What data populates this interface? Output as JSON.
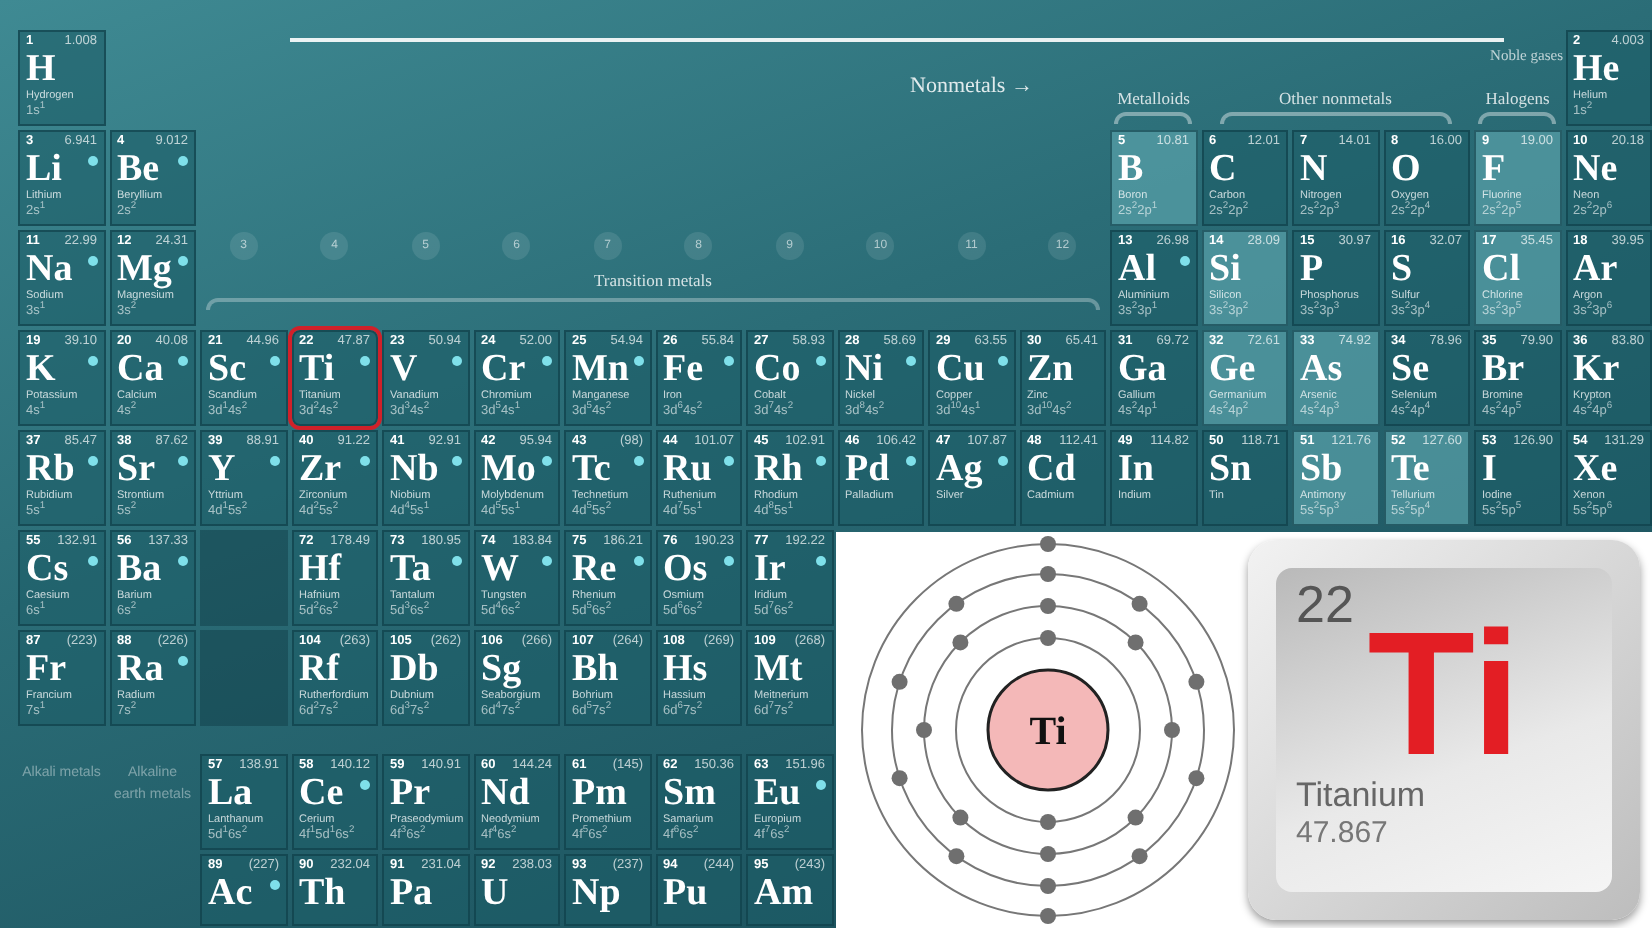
{
  "category_labels": {
    "nonmetals": "Nonmetals →",
    "metalloids": "Metalloids",
    "other_nonmetals": "Other nonmetals",
    "halogens": "Halogens",
    "noble_gases": "Noble gases",
    "transition_metals": "Transition metals",
    "alkali_metals": "Alkali metals",
    "alkaline_earth_metals": "Alkaline earth metals"
  },
  "group_numbers": [
    "3",
    "4",
    "5",
    "6",
    "7",
    "8",
    "9",
    "10",
    "11",
    "12"
  ],
  "elements": [
    {
      "number": "1",
      "mass": "1.008",
      "symbol": "H",
      "name": "Hydrogen",
      "config": "1s$^{1}$"
    },
    {
      "number": "2",
      "mass": "4.003",
      "symbol": "He",
      "name": "Helium",
      "config": "1s$^{2}$"
    },
    {
      "number": "3",
      "mass": "6.941",
      "symbol": "Li",
      "name": "Lithium",
      "config": "2s$^{1}$",
      "dot": true
    },
    {
      "number": "4",
      "mass": "9.012",
      "symbol": "Be",
      "name": "Beryllium",
      "config": "2s$^{2}$",
      "dot": true
    },
    {
      "number": "5",
      "mass": "10.81",
      "symbol": "B",
      "name": "Boron",
      "config": "2s$^{2}$2p$^{1}$",
      "light": true
    },
    {
      "number": "6",
      "mass": "12.01",
      "symbol": "C",
      "name": "Carbon",
      "config": "2s$^{2}$2p$^{2}$"
    },
    {
      "number": "7",
      "mass": "14.01",
      "symbol": "N",
      "name": "Nitrogen",
      "config": "2s$^{2}$2p$^{3}$"
    },
    {
      "number": "8",
      "mass": "16.00",
      "symbol": "O",
      "name": "Oxygen",
      "config": "2s$^{2}$2p$^{4}$"
    },
    {
      "number": "9",
      "mass": "19.00",
      "symbol": "F",
      "name": "Fluorine",
      "config": "2s$^{2}$2p$^{5}$",
      "light": true
    },
    {
      "number": "10",
      "mass": "20.18",
      "symbol": "Ne",
      "name": "Neon",
      "config": "2s$^{2}$2p$^{6}$"
    },
    {
      "number": "11",
      "mass": "22.99",
      "symbol": "Na",
      "name": "Sodium",
      "config": "3s$^{1}$",
      "dot": true
    },
    {
      "number": "12",
      "mass": "24.31",
      "symbol": "Mg",
      "name": "Magnesium",
      "config": "3s$^{2}$",
      "dot": true
    },
    {
      "number": "13",
      "mass": "26.98",
      "symbol": "Al",
      "name": "Aluminium",
      "config": "3s$^{2}$3p$^{1}$",
      "dot": true
    },
    {
      "number": "14",
      "mass": "28.09",
      "symbol": "Si",
      "name": "Silicon",
      "config": "3s$^{2}$3p$^{2}$",
      "light": true
    },
    {
      "number": "15",
      "mass": "30.97",
      "symbol": "P",
      "name": "Phosphorus",
      "config": "3s$^{2}$3p$^{3}$"
    },
    {
      "number": "16",
      "mass": "32.07",
      "symbol": "S",
      "name": "Sulfur",
      "config": "3s$^{2}$3p$^{4}$"
    },
    {
      "number": "17",
      "mass": "35.45",
      "symbol": "Cl",
      "name": "Chlorine",
      "config": "3s$^{2}$3p$^{5}$",
      "light": true
    },
    {
      "number": "18",
      "mass": "39.95",
      "symbol": "Ar",
      "name": "Argon",
      "config": "3s$^{2}$3p$^{6}$"
    },
    {
      "number": "19",
      "mass": "39.10",
      "symbol": "K",
      "name": "Potassium",
      "config": "4s$^{1}$",
      "dot": true
    },
    {
      "number": "20",
      "mass": "40.08",
      "symbol": "Ca",
      "name": "Calcium",
      "config": "4s$^{2}$",
      "dot": true
    },
    {
      "number": "21",
      "mass": "44.96",
      "symbol": "Sc",
      "name": "Scandium",
      "config": "3d$^{1}$4s$^{2}$",
      "dot": true
    },
    {
      "number": "22",
      "mass": "47.87",
      "symbol": "Ti",
      "name": "Titanium",
      "config": "3d$^{2}$4s$^{2}$",
      "dot": true,
      "circled": true
    },
    {
      "number": "23",
      "mass": "50.94",
      "symbol": "V",
      "name": "Vanadium",
      "config": "3d$^{3}$4s$^{2}$",
      "dot": true
    },
    {
      "number": "24",
      "mass": "52.00",
      "symbol": "Cr",
      "name": "Chromium",
      "config": "3d$^{5}$4s$^{1}$",
      "dot": true
    },
    {
      "number": "25",
      "mass": "54.94",
      "symbol": "Mn",
      "name": "Manganese",
      "config": "3d$^{5}$4s$^{2}$",
      "dot": true
    },
    {
      "number": "26",
      "mass": "55.84",
      "symbol": "Fe",
      "name": "Iron",
      "config": "3d$^{6}$4s$^{2}$",
      "dot": true
    },
    {
      "number": "27",
      "mass": "58.93",
      "symbol": "Co",
      "name": "Cobalt",
      "config": "3d$^{7}$4s$^{2}$",
      "dot": true
    },
    {
      "number": "28",
      "mass": "58.69",
      "symbol": "Ni",
      "name": "Nickel",
      "config": "3d$^{8}$4s$^{2}$",
      "dot": true
    },
    {
      "number": "29",
      "mass": "63.55",
      "symbol": "Cu",
      "name": "Copper",
      "config": "3d$^{10}$4s$^{1}$",
      "dot": true
    },
    {
      "number": "30",
      "mass": "65.41",
      "symbol": "Zn",
      "name": "Zinc",
      "config": "3d$^{10}$4s$^{2}$"
    },
    {
      "number": "31",
      "mass": "69.72",
      "symbol": "Ga",
      "name": "Gallium",
      "config": "4s$^{2}$4p$^{1}$"
    },
    {
      "number": "32",
      "mass": "72.61",
      "symbol": "Ge",
      "name": "Germanium",
      "config": "4s$^{2}$4p$^{2}$",
      "light": true
    },
    {
      "number": "33",
      "mass": "74.92",
      "symbol": "As",
      "name": "Arsenic",
      "config": "4s$^{2}$4p$^{3}$",
      "light": true
    },
    {
      "number": "34",
      "mass": "78.96",
      "symbol": "Se",
      "name": "Selenium",
      "config": "4s$^{2}$4p$^{4}$"
    },
    {
      "number": "35",
      "mass": "79.90",
      "symbol": "Br",
      "name": "Bromine",
      "config": "4s$^{2}$4p$^{5}$"
    },
    {
      "number": "36",
      "mass": "83.80",
      "symbol": "Kr",
      "name": "Krypton",
      "config": "4s$^{2}$4p$^{6}$"
    },
    {
      "number": "37",
      "mass": "85.47",
      "symbol": "Rb",
      "name": "Rubidium",
      "config": "5s$^{1}$",
      "dot": true
    },
    {
      "number": "38",
      "mass": "87.62",
      "symbol": "Sr",
      "name": "Strontium",
      "config": "5s$^{2}$",
      "dot": true
    },
    {
      "number": "39",
      "mass": "88.91",
      "symbol": "Y",
      "name": "Yttrium",
      "config": "4d$^{1}$5s$^{2}$",
      "dot": true
    },
    {
      "number": "40",
      "mass": "91.22",
      "symbol": "Zr",
      "name": "Zirconium",
      "config": "4d$^{2}$5s$^{2}$",
      "dot": true
    },
    {
      "number": "41",
      "mass": "92.91",
      "symbol": "Nb",
      "name": "Niobium",
      "config": "4d$^{4}$5s$^{1}$",
      "dot": true
    },
    {
      "number": "42",
      "mass": "95.94",
      "symbol": "Mo",
      "name": "Molybdenum",
      "config": "4d$^{5}$5s$^{1}$",
      "dot": true
    },
    {
      "number": "43",
      "mass": "(98)",
      "symbol": "Tc",
      "name": "Technetium",
      "config": "4d$^{5}$5s$^{2}$",
      "dot": true
    },
    {
      "number": "44",
      "mass": "101.07",
      "symbol": "Ru",
      "name": "Ruthenium",
      "config": "4d$^{7}$5s$^{1}$",
      "dot": true
    },
    {
      "number": "45",
      "mass": "102.91",
      "symbol": "Rh",
      "name": "Rhodium",
      "config": "4d$^{8}$5s$^{1}$",
      "dot": true
    },
    {
      "number": "46",
      "mass": "106.42",
      "symbol": "Pd",
      "name": "Palladium",
      "dot": true
    },
    {
      "number": "47",
      "mass": "107.87",
      "symbol": "Ag",
      "name": "Silver",
      "dot": true
    },
    {
      "number": "48",
      "mass": "112.41",
      "symbol": "Cd",
      "name": "Cadmium"
    },
    {
      "number": "49",
      "mass": "114.82",
      "symbol": "In",
      "name": "Indium"
    },
    {
      "number": "50",
      "mass": "118.71",
      "symbol": "Sn",
      "name": "Tin"
    },
    {
      "number": "51",
      "mass": "121.76",
      "symbol": "Sb",
      "name": "Antimony",
      "config": "5s$^{2}$5p$^{3}$",
      "light": true
    },
    {
      "number": "52",
      "mass": "127.60",
      "symbol": "Te",
      "name": "Tellurium",
      "config": "5s$^{2}$5p$^{4}$",
      "light": true
    },
    {
      "number": "53",
      "mass": "126.90",
      "symbol": "I",
      "name": "Iodine",
      "config": "5s$^{2}$5p$^{5}$"
    },
    {
      "number": "54",
      "mass": "131.29",
      "symbol": "Xe",
      "name": "Xenon",
      "config": "5s$^{2}$5p$^{6}$"
    },
    {
      "number": "55",
      "mass": "132.91",
      "symbol": "Cs",
      "name": "Caesium",
      "config": "6s$^{1}$",
      "dot": true
    },
    {
      "number": "56",
      "mass": "137.33",
      "symbol": "Ba",
      "name": "Barium",
      "config": "6s$^{2}$",
      "dot": true
    },
    {
      "number": "72",
      "mass": "178.49",
      "symbol": "Hf",
      "name": "Hafnium",
      "config": "5d$^{2}$6s$^{2}$"
    },
    {
      "number": "73",
      "mass": "180.95",
      "symbol": "Ta",
      "name": "Tantalum",
      "config": "5d$^{3}$6s$^{2}$",
      "dot": true
    },
    {
      "number": "74",
      "mass": "183.84",
      "symbol": "W",
      "name": "Tungsten",
      "config": "5d$^{4}$6s$^{2}$",
      "dot": true
    },
    {
      "number": "75",
      "mass": "186.21",
      "symbol": "Re",
      "name": "Rhenium",
      "config": "5d$^{5}$6s$^{2}$",
      "dot": true
    },
    {
      "number": "76",
      "mass": "190.23",
      "symbol": "Os",
      "name": "Osmium",
      "config": "5d$^{6}$6s$^{2}$",
      "dot": true
    },
    {
      "number": "77",
      "mass": "192.22",
      "symbol": "Ir",
      "name": "Iridium",
      "config": "5d$^{7}$6s$^{2}$",
      "dot": true
    },
    {
      "number": "87",
      "mass": "(223)",
      "symbol": "Fr",
      "name": "Francium",
      "config": "7s$^{1}$"
    },
    {
      "number": "88",
      "mass": "(226)",
      "symbol": "Ra",
      "name": "Radium",
      "config": "7s$^{2}$",
      "dot": true
    },
    {
      "number": "104",
      "mass": "(263)",
      "symbol": "Rf",
      "name": "Rutherfordium",
      "config": "6d$^{2}$7s$^{2}$"
    },
    {
      "number": "105",
      "mass": "(262)",
      "symbol": "Db",
      "name": "Dubnium",
      "config": "6d$^{3}$7s$^{2}$"
    },
    {
      "number": "106",
      "mass": "(266)",
      "symbol": "Sg",
      "name": "Seaborgium",
      "config": "6d$^{4}$7s$^{2}$"
    },
    {
      "number": "107",
      "mass": "(264)",
      "symbol": "Bh",
      "name": "Bohrium",
      "config": "6d$^{5}$7s$^{2}$"
    },
    {
      "number": "108",
      "mass": "(269)",
      "symbol": "Hs",
      "name": "Hassium",
      "config": "6d$^{6}$7s$^{2}$"
    },
    {
      "number": "109",
      "mass": "(268)",
      "symbol": "Mt",
      "name": "Meitnerium",
      "config": "6d$^{7}$7s$^{2}$"
    }
  ],
  "lanthanides": [
    {
      "number": "57",
      "mass": "138.91",
      "symbol": "La",
      "name": "Lanthanum",
      "config": "5d$^{1}$6s$^{2}$"
    },
    {
      "number": "58",
      "mass": "140.12",
      "symbol": "Ce",
      "name": "Cerium",
      "config": "4f$^{1}$5d$^{1}$6s$^{2}$",
      "dot": true
    },
    {
      "number": "59",
      "mass": "140.91",
      "symbol": "Pr",
      "name": "Praseodymium",
      "config": "4f$^{3}$6s$^{2}$"
    },
    {
      "number": "60",
      "mass": "144.24",
      "symbol": "Nd",
      "name": "Neodymium",
      "config": "4f$^{4}$6s$^{2}$"
    },
    {
      "number": "61",
      "mass": "(145)",
      "symbol": "Pm",
      "name": "Promethium",
      "config": "4f$^{5}$6s$^{2}$"
    },
    {
      "number": "62",
      "mass": "150.36",
      "symbol": "Sm",
      "name": "Samarium",
      "config": "4f$^{6}$6s$^{2}$"
    },
    {
      "number": "63",
      "mass": "151.96",
      "symbol": "Eu",
      "name": "Europium",
      "config": "4f$^{7}$6s$^{2}$",
      "dot": true
    }
  ],
  "actinides": [
    {
      "number": "89",
      "mass": "(227)",
      "symbol": "Ac",
      "dot": true
    },
    {
      "number": "90",
      "mass": "232.04",
      "symbol": "Th"
    },
    {
      "number": "91",
      "mass": "231.04",
      "symbol": "Pa"
    },
    {
      "number": "92",
      "mass": "238.03",
      "symbol": "U"
    },
    {
      "number": "93",
      "mass": "(237)",
      "symbol": "Np"
    },
    {
      "number": "94",
      "mass": "(244)",
      "symbol": "Pu"
    },
    {
      "number": "95",
      "mass": "(243)",
      "symbol": "Am"
    }
  ],
  "overlay": {
    "bohr_nucleus": "Ti",
    "key": {
      "number": "22",
      "symbol": "Ti",
      "name": "Titanium",
      "mass": "47.867"
    }
  }
}
